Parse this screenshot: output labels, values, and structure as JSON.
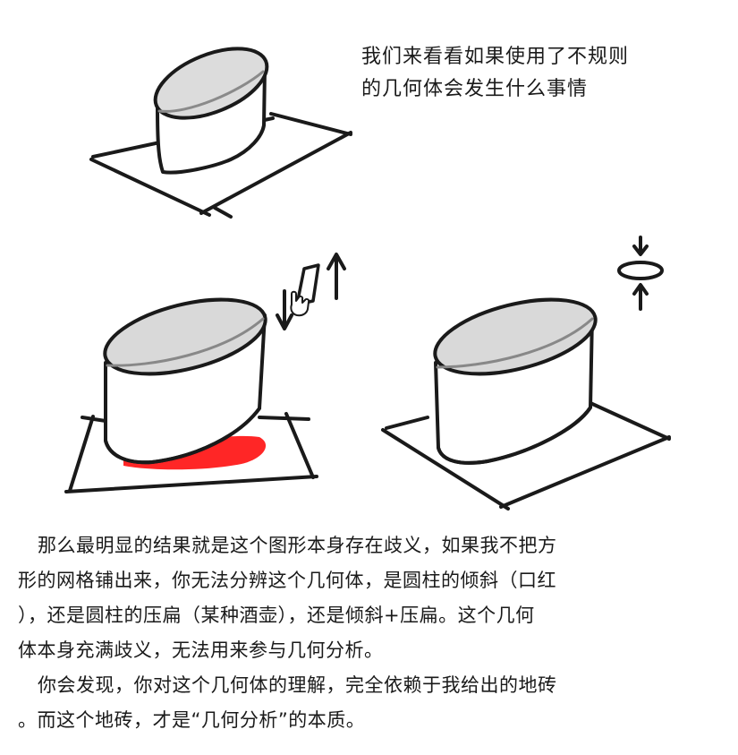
{
  "caption": {
    "line1": "我们来看看如果使用了不规则",
    "line2": "的几何体会发生什么事情"
  },
  "paragraphs": {
    "p1_l1": "那么最明显的结果就是这个图形本身存在歧义，如果我不把方",
    "p1_l2": "形的网格铺出来，你无法分辨这个几何体，是圆柱的倾斜（口红",
    "p1_l3": "），还是圆柱的压扁（某种酒壶），还是倾斜+压扁。这个几何",
    "p1_l4": "体本身充满歧义，无法用来参与几何分析。",
    "p2_l1": "你会发现，你对这个几何体的理解，完全依赖于我给出的地砖",
    "p2_l2": "。而这个地砖，才是“几何分析”的本质。"
  },
  "colors": {
    "ink": "#1a1a1a",
    "shadow": "#ff1a1a",
    "cylinder_top": "#d9d9d9"
  },
  "icons": [
    "hand-cursor-icon",
    "up-arrow-icon",
    "down-arrow-icon",
    "ellipse-compress-icon"
  ]
}
